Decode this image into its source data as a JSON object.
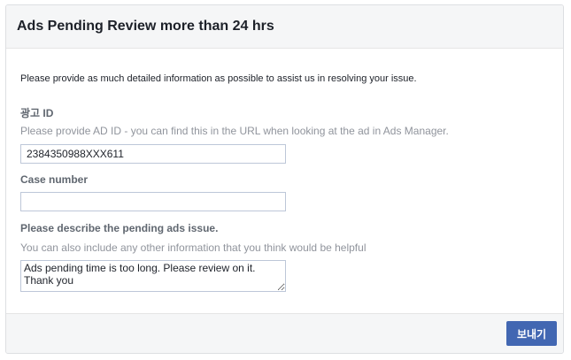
{
  "form": {
    "title": "Ads Pending Review more than 24 hrs",
    "intro": "Please provide as much detailed information as possible to assist us in resolving your issue.",
    "ad_id": {
      "label": "광고 ID",
      "help": "Please provide AD ID - you can find this in the URL when looking at the ad in Ads Manager.",
      "value": "2384350988XXX611"
    },
    "case_number": {
      "label": "Case number",
      "value": ""
    },
    "issue": {
      "label": "Please describe the pending ads issue.",
      "help": "You can also include any other information that you think would be helpful",
      "value": "Ads pending time is too long. Please review on it.\nThank you"
    },
    "submit_label": "보내기"
  },
  "colors": {
    "header_bg": "#f5f6f7",
    "button_bg": "#4267b2",
    "label_text": "#606770",
    "help_text": "#90949c"
  }
}
